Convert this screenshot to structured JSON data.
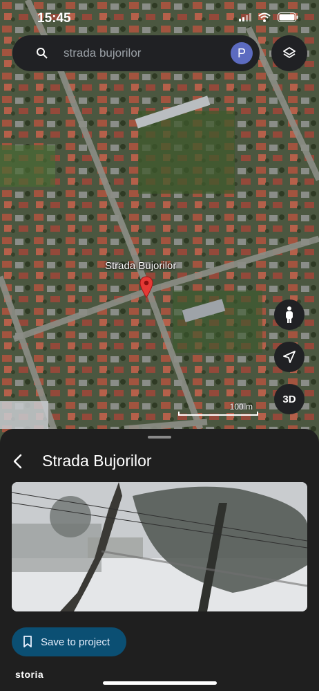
{
  "status_bar": {
    "time": "15:45"
  },
  "search": {
    "placeholder": "strada bujorilor",
    "avatar_letter": "P"
  },
  "map": {
    "place_label": "Strada Bujorilor",
    "scale_label": "100 m",
    "button_3d": "3D"
  },
  "icons": {
    "search": "search-icon",
    "layers": "layers-icon",
    "pegman": "pegman-icon",
    "locate": "navigation-arrow-icon",
    "pin": "map-pin-icon",
    "back": "back-arrow-icon",
    "bookmark": "bookmark-icon"
  },
  "sheet": {
    "title": "Strada Bujorilor",
    "save_label": "Save to project",
    "brand": "storia"
  },
  "colors": {
    "pin": "#e53935",
    "save_button": "#0b4f73",
    "avatar": "#5c6bc0",
    "sheet_bg": "#1f1f1f"
  }
}
